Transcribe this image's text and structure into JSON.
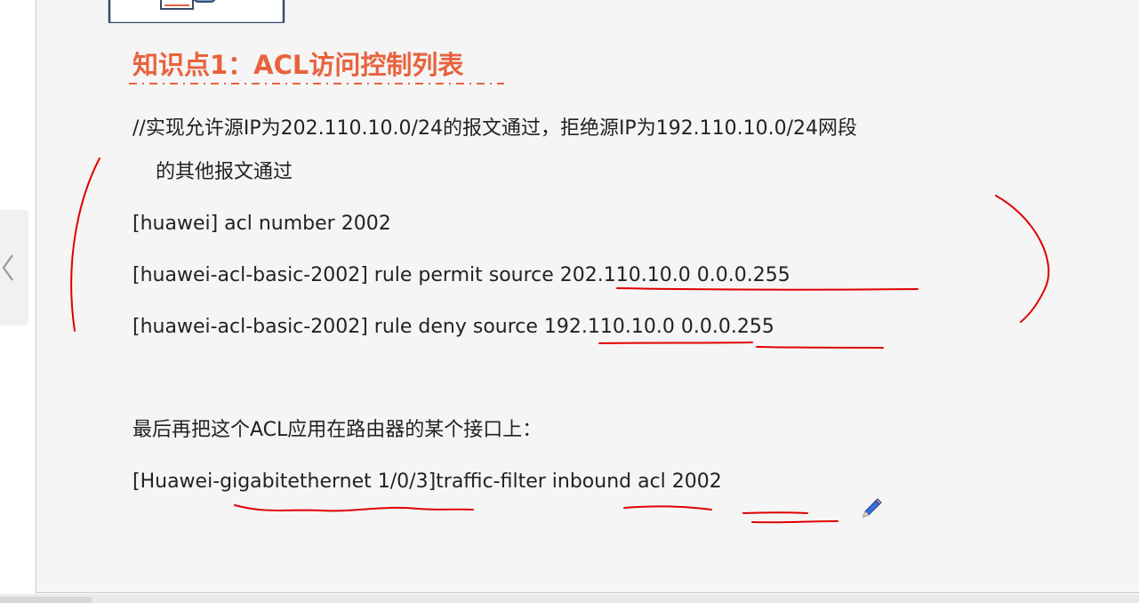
{
  "title": "知识点1：ACL访问控制列表",
  "comment_line1": "//实现允许源IP为202.110.10.0/24的报文通过，拒绝源IP为192.110.10.0/24网段",
  "comment_line2": "的其他报文通过",
  "cmd1": "[huawei] acl number 2002",
  "cmd2": "[huawei-acl-basic-2002] rule permit source 202.110.10.0 0.0.0.255",
  "cmd3": "[huawei-acl-basic-2002] rule deny source 192.110.10.0 0.0.0.255",
  "apply_text": "最后再把这个ACL应用在路由器的某个接口上：",
  "cmd4": "[Huawei-gigabitethernet 1/0/3]traffic-filter inbound acl 2002",
  "icons": {
    "prev": "chevron-left-icon",
    "pen": "pencil-icon",
    "header": "document-illustration"
  },
  "colors": {
    "title": "#e8633d",
    "annotation": "#e00000",
    "text": "#222222"
  }
}
